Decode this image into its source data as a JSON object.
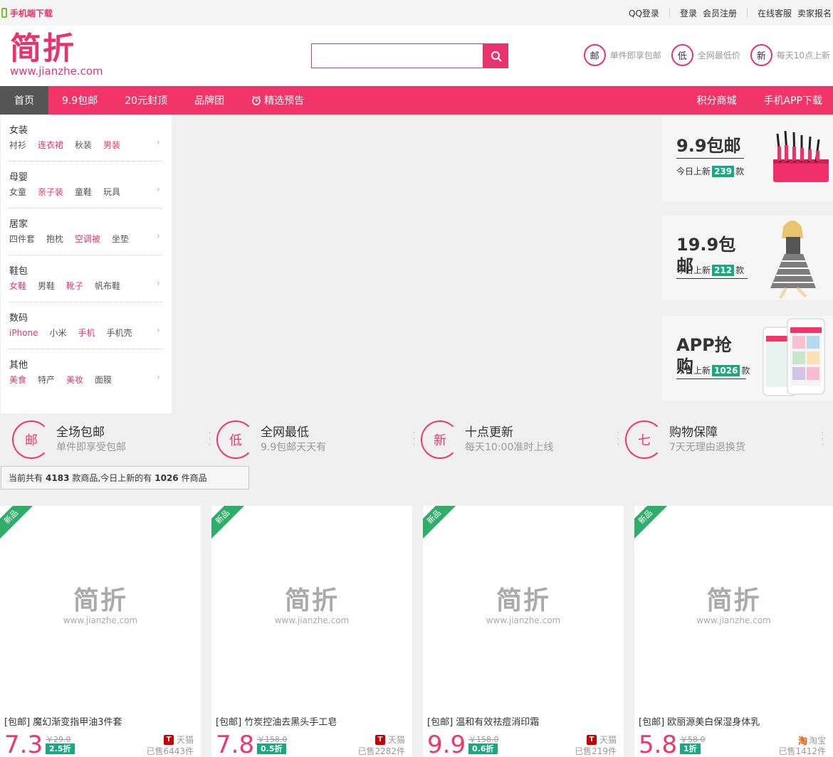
{
  "topbar": {
    "mobile_download": "手机端下载",
    "qq_login": "QQ登录",
    "login": "登录",
    "register": "会员注册",
    "online_service": "在线客服",
    "seller_signup": "卖家报名"
  },
  "header": {
    "logo_text": "简折",
    "logo_url": "www.jianzhe.com",
    "search_placeholder": "",
    "promises": [
      {
        "icon": "邮",
        "text": "单件即享包邮"
      },
      {
        "icon": "低",
        "text": "全网最低价"
      },
      {
        "icon": "新",
        "text": "每天10点上新"
      }
    ]
  },
  "nav": {
    "left": [
      "首页",
      "9.9包邮",
      "20元封顶",
      "品牌团",
      "精选预告"
    ],
    "right": [
      "积分商城",
      "手机APP下载"
    ]
  },
  "categories": [
    {
      "title": "女装",
      "subs": [
        "衬衫",
        "连衣裙",
        "秋装",
        "男装"
      ],
      "hot": [
        false,
        true,
        false,
        true
      ]
    },
    {
      "title": "母婴",
      "subs": [
        "女童",
        "亲子装",
        "童鞋",
        "玩具"
      ],
      "hot": [
        false,
        true,
        false,
        false
      ]
    },
    {
      "title": "居家",
      "subs": [
        "四件套",
        "抱枕",
        "空调被",
        "坐垫"
      ],
      "hot": [
        false,
        false,
        true,
        false
      ]
    },
    {
      "title": "鞋包",
      "subs": [
        "女鞋",
        "男鞋",
        "靴子",
        "帆布鞋"
      ],
      "hot": [
        true,
        false,
        true,
        false
      ]
    },
    {
      "title": "数码",
      "subs": [
        "iPhone",
        "小米",
        "手机",
        "手机壳"
      ],
      "hot": [
        true,
        false,
        true,
        false
      ]
    },
    {
      "title": "其他",
      "subs": [
        "美食",
        "特产",
        "美妆",
        "面膜"
      ],
      "hot": [
        true,
        false,
        true,
        false
      ]
    }
  ],
  "promos": [
    {
      "title": "9.9包邮",
      "prefix": "今日上新",
      "count": "239",
      "suffix": "款"
    },
    {
      "title": "19.9包邮",
      "prefix": "今日上新",
      "count": "212",
      "suffix": "款"
    },
    {
      "title": "APP抢购",
      "prefix": "今日上新",
      "count": "1026",
      "suffix": "款"
    }
  ],
  "features": [
    {
      "icon": "邮",
      "title": "全场包邮",
      "sub": "单件即享受包邮"
    },
    {
      "icon": "低",
      "title": "全网最低",
      "sub": "9.9包邮天天有"
    },
    {
      "icon": "新",
      "title": "十点更新",
      "sub": "每天10:00准时上线"
    },
    {
      "icon": "七",
      "title": "购物保障",
      "sub": "7天无理由退换货"
    }
  ],
  "stats": {
    "prefix": "当前共有",
    "total": "4183",
    "middle": "款商品,今日上新的有",
    "today": "1026",
    "suffix": "件商品"
  },
  "products": [
    {
      "badge": "新品",
      "wm_main": "简折",
      "wm_url": "www.jianzhe.com",
      "title": "[包邮] 魔幻渐变指甲油3件套",
      "price": "7.3",
      "old_price": "￥29.0",
      "discount": "2.5折",
      "shop": "天猫",
      "shop_type": "tmall",
      "sold": "已售6443件"
    },
    {
      "badge": "新品",
      "wm_main": "简折",
      "wm_url": "www.jianzhe.com",
      "title": "[包邮] 竹炭控油去黑头手工皂",
      "price": "7.8",
      "old_price": "￥158.0",
      "discount": "0.5折",
      "shop": "天猫",
      "shop_type": "tmall",
      "sold": "已售2282件"
    },
    {
      "badge": "新品",
      "wm_main": "简折",
      "wm_url": "www.jianzhe.com",
      "title": "[包邮] 温和有效祛痘消印霜",
      "price": "9.9",
      "old_price": "￥158.0",
      "discount": "0.6折",
      "shop": "天猫",
      "shop_type": "tmall",
      "sold": "已售219件"
    },
    {
      "badge": "新品",
      "wm_main": "简折",
      "wm_url": "www.jianzhe.com",
      "title": "[包邮] 欧丽源美白保湿身体乳",
      "price": "5.8",
      "old_price": "￥58.0",
      "discount": "1折",
      "shop": "淘宝",
      "shop_type": "taobao",
      "sold": "已售1412件"
    }
  ]
}
